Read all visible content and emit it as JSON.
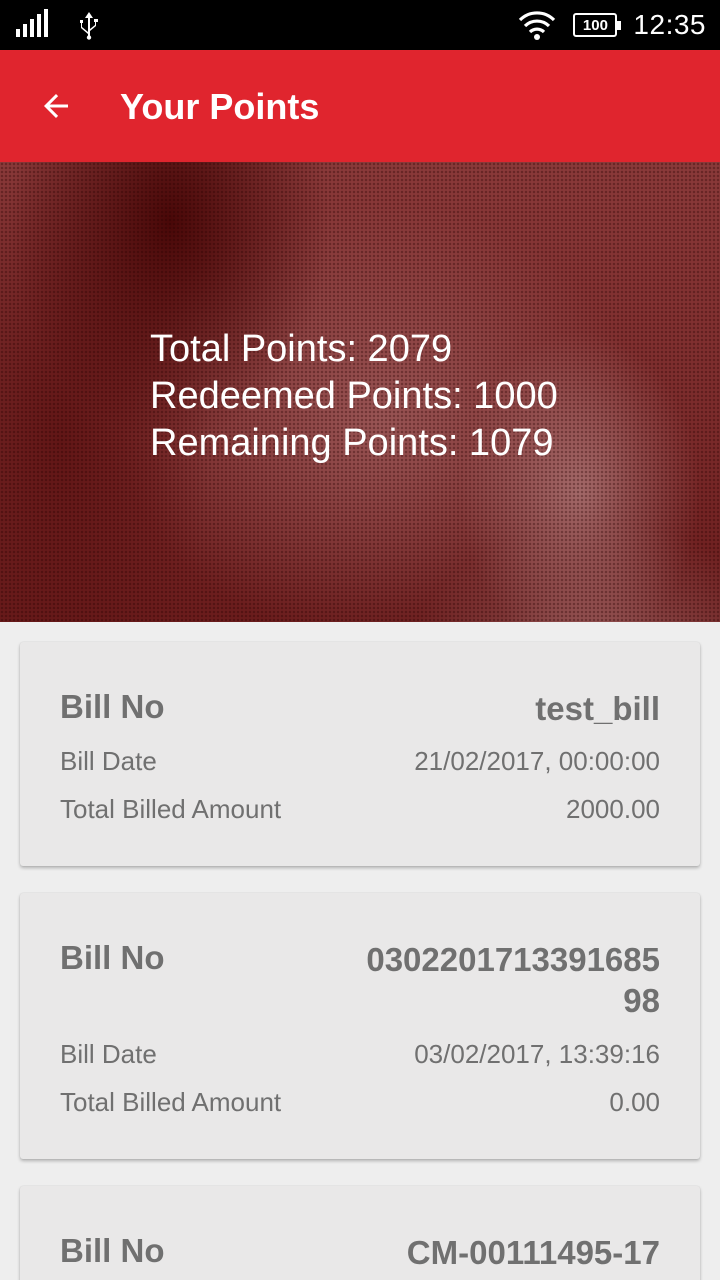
{
  "status_bar": {
    "time": "12:35",
    "battery": "100",
    "icons": [
      "signal-icon",
      "usb-icon",
      "wifi-icon",
      "battery-icon"
    ]
  },
  "app_bar": {
    "title": "Your Points",
    "back_icon": "arrow-back-icon",
    "color": "#e0252e"
  },
  "points": {
    "total": "Total Points: 2079",
    "redeemed": "Redeemed Points: 1000",
    "remaining": "Remaining Points: 1079"
  },
  "bills": [
    {
      "bill_no_label": "Bill No",
      "bill_no": "test_bill",
      "date_label": "Bill Date",
      "date": "21/02/2017, 00:00:00",
      "amount_label": "Total Billed Amount",
      "amount": "2000.00"
    },
    {
      "bill_no_label": "Bill No",
      "bill_no": "030220171339168598",
      "date_label": "Bill Date",
      "date": "03/02/2017, 13:39:16",
      "amount_label": "Total Billed Amount",
      "amount": "0.00"
    },
    {
      "bill_no_label": "Bill No",
      "bill_no": "CM-00111495-17"
    }
  ]
}
